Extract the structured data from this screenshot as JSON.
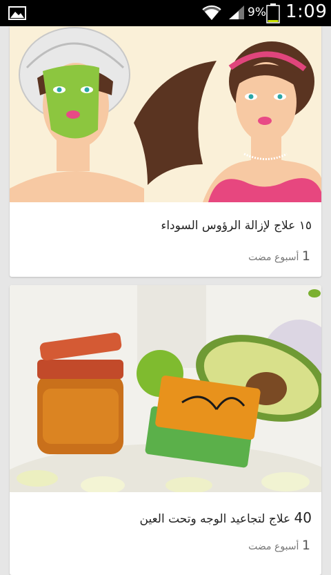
{
  "status_bar": {
    "battery_percent": "9%",
    "time": "1:09",
    "icons": [
      "gallery-icon",
      "wifi-icon",
      "signal-icon",
      "battery-icon"
    ]
  },
  "feed": [
    {
      "title": "١٥ علاج لإزالة الرؤوس السوداء",
      "meta_number": "1",
      "meta_text": "أسبوع مضت"
    },
    {
      "title_number": "40",
      "title_text": "علاج لتجاعيد الوجه وتحت العين",
      "meta_number": "1",
      "meta_text": "أسبوع مضت"
    }
  ]
}
